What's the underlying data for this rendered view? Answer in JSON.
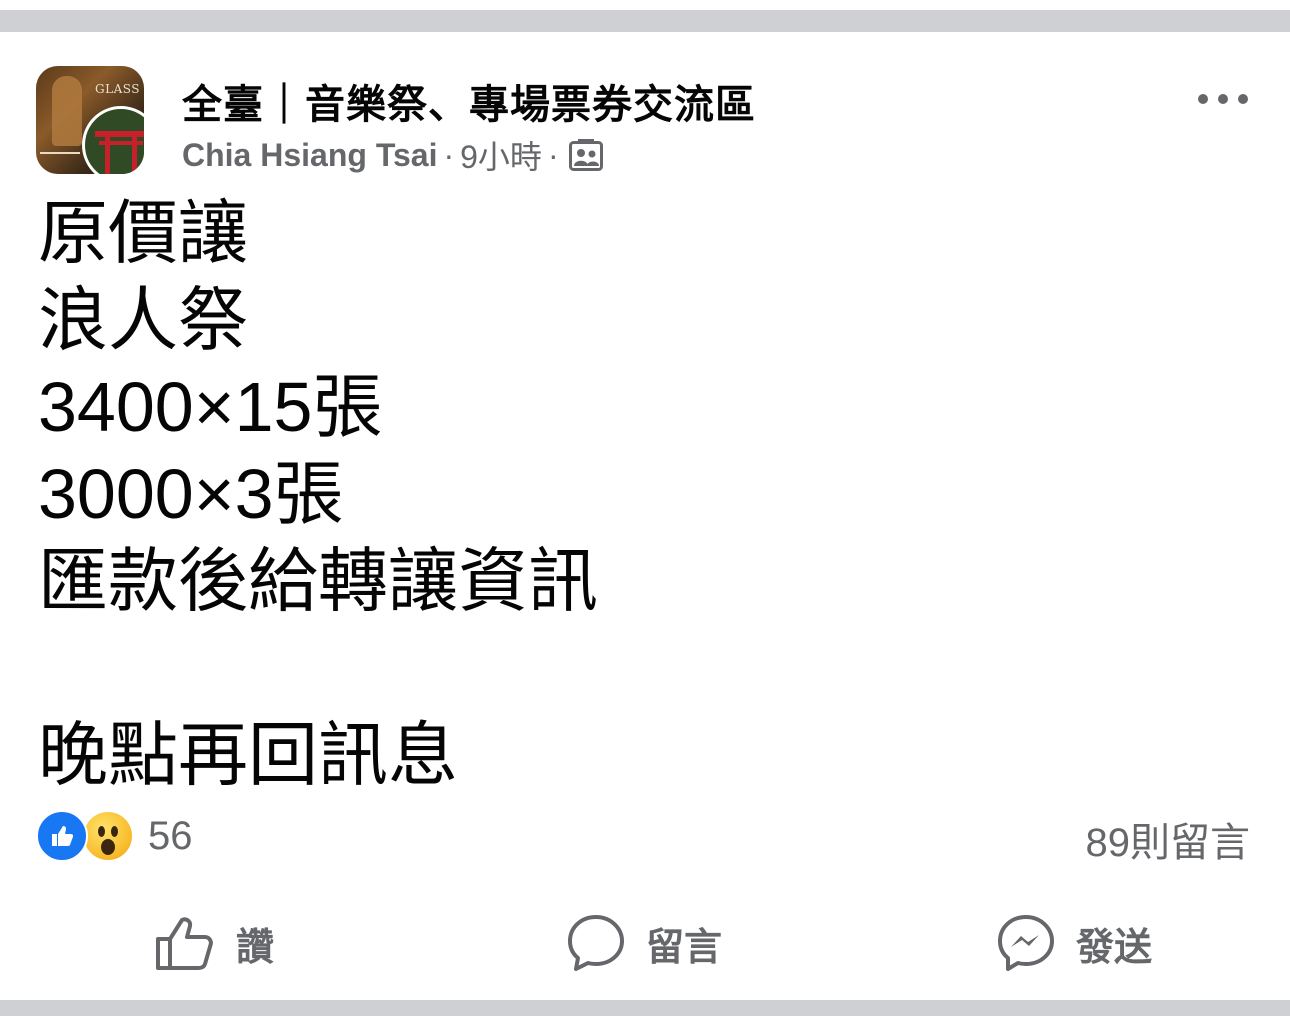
{
  "post": {
    "group_name": "全臺｜音樂祭、專場票券交流區",
    "author": "Chia Hsiang Tsai",
    "separator": "·",
    "time": "9小時",
    "avatar_logo_text": "GLASS",
    "body_lines": [
      "原價讓",
      "浪人祭",
      "3400×15張",
      "3000×3張",
      "匯款後給轉讓資訊",
      "",
      "晚點再回訊息"
    ]
  },
  "reactions": {
    "count": "56",
    "types": [
      "like",
      "wow"
    ]
  },
  "comments": {
    "count_label": "89則留言"
  },
  "actions": {
    "like_label": "讚",
    "comment_label": "留言",
    "send_label": "發送"
  },
  "icons": [
    "more-options-icon",
    "audience-icon",
    "like-reaction-icon",
    "wow-reaction-icon",
    "like-icon",
    "comment-icon",
    "messenger-icon"
  ],
  "colors": {
    "facebook_blue": "#1877f2",
    "secondary_text": "#65676b",
    "divider": "#ced0d4"
  }
}
